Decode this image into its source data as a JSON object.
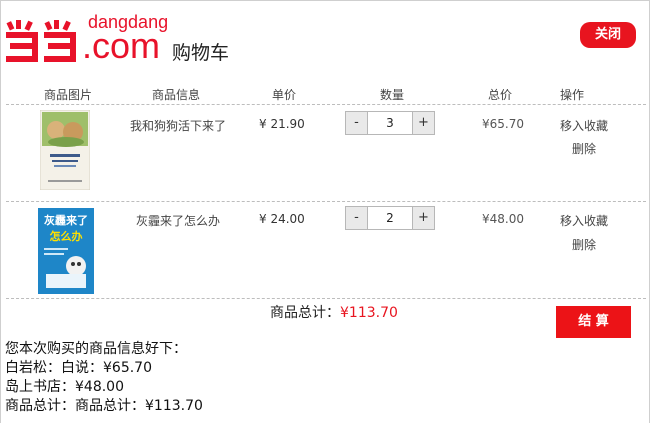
{
  "header": {
    "logo_small": "dangdang",
    "logo_big": ".com",
    "cart_title": "购物车",
    "close_label": "关闭",
    "accent": "#e8141f"
  },
  "table": {
    "columns": [
      "商品图片",
      "商品信息",
      "单价",
      "数量",
      "总价",
      "操作"
    ]
  },
  "items": [
    {
      "name": "我和狗狗活下来了",
      "unit_price": "¥ 21.90",
      "quantity": "3",
      "total": "¥65.70",
      "actions": [
        "移入收藏",
        "删除"
      ],
      "cover_text": "我和狗狗活下来了"
    },
    {
      "name": "灰霾来了怎么办",
      "unit_price": "¥ 24.00",
      "quantity": "2",
      "total": "¥48.00",
      "actions": [
        "移入收藏",
        "删除"
      ],
      "cover_text": "灰霾来了怎么办"
    }
  ],
  "qty_controls": {
    "minus": "-",
    "plus": "+"
  },
  "summary": {
    "label": "商品总计：",
    "value": "¥113.70",
    "checkout_label": "结 算"
  },
  "info": {
    "lines": [
      "您本次购买的商品信息好下：",
      "白岩松：白说：¥65.70",
      "岛上书店：¥48.00",
      "商品总计：商品总计：¥113.70"
    ]
  }
}
